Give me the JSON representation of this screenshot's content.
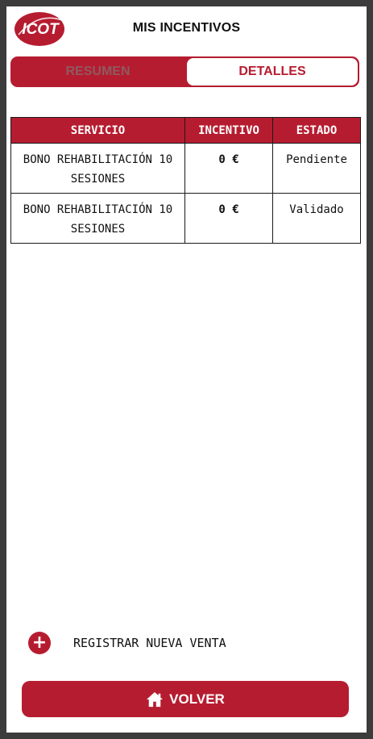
{
  "app": {
    "logo_text": "ICOT",
    "title": "MIS INCENTIVOS"
  },
  "tabs": [
    {
      "label": "RESUMEN",
      "active": false
    },
    {
      "label": "DETALLES",
      "active": true
    }
  ],
  "table": {
    "headers": {
      "servicio": "SERVICIO",
      "incentivo": "INCENTIVO",
      "estado": "ESTADO"
    },
    "rows": [
      {
        "servicio": "BONO REHABILITACIÓN 10 SESIONES",
        "incentivo": "0 €",
        "estado": "Pendiente"
      },
      {
        "servicio": "BONO REHABILITACIÓN 10 SESIONES",
        "incentivo": "0 €",
        "estado": "Validado"
      }
    ]
  },
  "actions": {
    "register_label": "REGISTRAR NUEVA VENTA",
    "register_icon": "plus-circle-icon",
    "back_label": "VOLVER",
    "back_icon": "home-icon"
  },
  "colors": {
    "brand": "#b61c30",
    "text": "#111111",
    "frame": "#3c3c3c"
  }
}
